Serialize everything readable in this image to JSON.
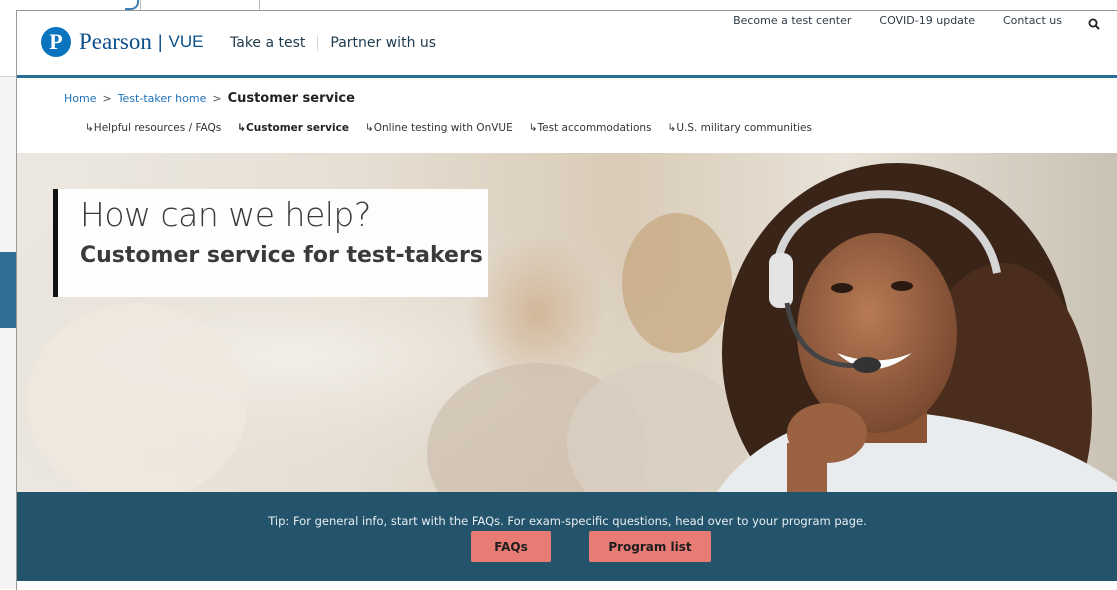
{
  "brand": {
    "logo_letter": "P",
    "name": "Pearson",
    "separator": "|",
    "product": "VUE"
  },
  "main_nav": [
    {
      "label": "Take a test"
    },
    {
      "label": "Partner with us"
    }
  ],
  "utility_nav": [
    {
      "label": "Become a test center"
    },
    {
      "label": "COVID-19 update"
    },
    {
      "label": "Contact us"
    }
  ],
  "search": {
    "icon": "search-icon"
  },
  "breadcrumb": {
    "items": [
      "Home",
      "Test-taker home"
    ],
    "separator": ">",
    "current": "Customer service"
  },
  "subnav": [
    {
      "label": "↳Helpful resources / FAQs"
    },
    {
      "label": "↳Customer service"
    },
    {
      "label": "↳Online testing with OnVUE"
    },
    {
      "label": "↳Test accommodations"
    },
    {
      "label": "↳U.S. military communities"
    }
  ],
  "hero": {
    "headline": "How can we help?",
    "subheadline": "Customer service for test-takers"
  },
  "tip": {
    "text": "Tip: For general info, start with the FAQs. For exam-specific questions, head over to your program page.",
    "buttons": [
      {
        "label": "FAQs"
      },
      {
        "label": "Program list"
      }
    ]
  },
  "colors": {
    "brand_blue": "#0a74bf",
    "band": "#24546c",
    "button": "#e87c74",
    "header_rule": "#2a6e96"
  }
}
